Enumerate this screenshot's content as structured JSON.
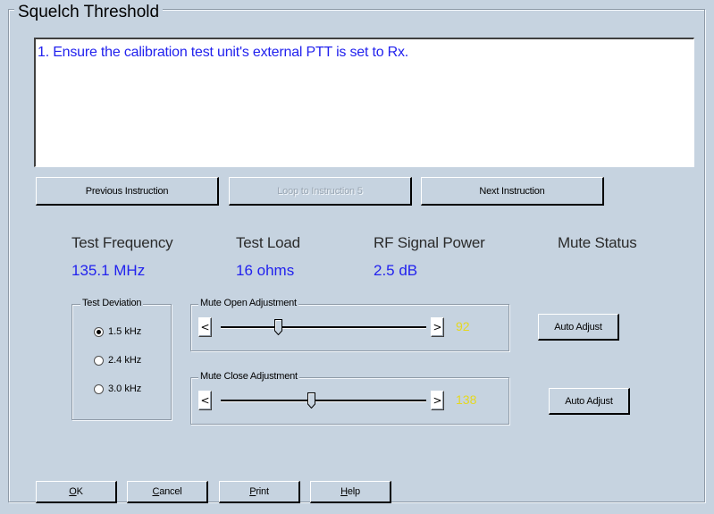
{
  "header": {
    "title": "Squelch Threshold"
  },
  "instruction": {
    "text": "1. Ensure the calibration test unit's external PTT is set to Rx."
  },
  "nav_buttons": {
    "previous": "Previous Instruction",
    "loop": "Loop to Instruction 5",
    "next": "Next Instruction"
  },
  "info": {
    "test_frequency": {
      "label": "Test Frequency",
      "value": "135.1 MHz"
    },
    "test_load": {
      "label": "Test Load",
      "value": "16 ohms"
    },
    "rf_signal_power": {
      "label": "RF Signal Power",
      "value": "2.5 dB"
    },
    "mute_status": {
      "label": "Mute Status",
      "value": ""
    }
  },
  "test_deviation": {
    "title": "Test Deviation",
    "options": [
      "1.5 kHz",
      "2.4 kHz",
      "3.0 kHz"
    ],
    "selected": "1.5 kHz"
  },
  "mute_open": {
    "title": "Mute Open Adjustment",
    "value": "92",
    "level_fraction": 0.27,
    "left_arrow": "<",
    "right_arrow": ">",
    "auto_label": "Auto Adjust"
  },
  "mute_close": {
    "title": "Mute Close Adjustment",
    "value": "138",
    "level_fraction": 0.44,
    "left_arrow": "<",
    "right_arrow": ">",
    "auto_label": "Auto Adjust"
  },
  "footer": {
    "ok_first": "O",
    "ok_rest": "K",
    "cancel_first": "C",
    "cancel_rest": "ancel",
    "print_first": "P",
    "print_rest": "rint",
    "help_first": "H",
    "help_rest": "elp"
  },
  "colors": {
    "background": "#c6d3e0",
    "value_text": "#2222ee",
    "readout_text": "#e5d81f"
  }
}
